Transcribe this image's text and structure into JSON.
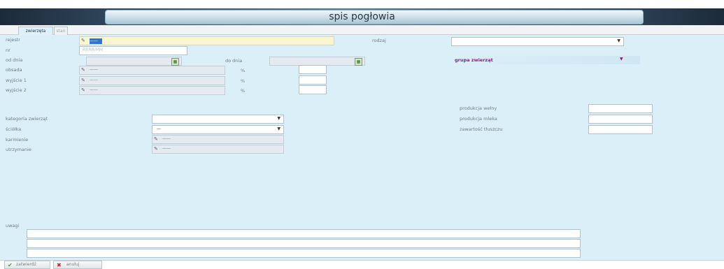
{
  "window": {
    "title": "spis pogłowia"
  },
  "tabs": [
    {
      "label": "zwierzęta",
      "active": true
    },
    {
      "label": "stan",
      "active": false
    }
  ],
  "form": {
    "rejestr": {
      "label": "rejestr",
      "value": "——"
    },
    "nr": {
      "label": "nr",
      "placeholder": "RRRR/MM"
    },
    "od_dnia": {
      "label": "od dnia"
    },
    "do_dnia": {
      "label": "do dnia"
    },
    "rodzaj": {
      "label": "rodzaj"
    },
    "obsada": {
      "label": "obsada",
      "value": "——",
      "unit": "%"
    },
    "wyjsce1": {
      "label": "wyjście 1",
      "value": "——",
      "unit": "%"
    },
    "wyjsce2": {
      "label": "wyjście 2",
      "value": "——",
      "unit": "%"
    },
    "grupa": {
      "label": "grupa zwierząt"
    },
    "kategoria": {
      "label": "kategoria zwierząt"
    },
    "sciolka": {
      "label": "ściółka",
      "value": "—"
    },
    "karmienie": {
      "label": "karmienie",
      "value": "——"
    },
    "utrzymanie": {
      "label": "utrzymanie",
      "value": "——"
    },
    "produkcja_welny": {
      "label": "produkcja wełny"
    },
    "produkcja_mleka": {
      "label": "produkcja mleka"
    },
    "zawartosc_tluszczu": {
      "label": "zawartość tłuszczu"
    },
    "uwagi": {
      "label": "uwagi"
    }
  },
  "buttons": {
    "save": "zatwierdź",
    "cancel": "anuluj"
  },
  "icons": {
    "picker": "lookup-icon",
    "calendar": "calendar-icon",
    "dropdown": "chevron-down-icon",
    "save": "checkmark-icon",
    "cancel": "close-icon"
  },
  "colors": {
    "accent_purple": "#8a1f7a",
    "panel": "#dbeff9",
    "highlight": "#2a76d2",
    "required_field": "#fbf6cf"
  }
}
